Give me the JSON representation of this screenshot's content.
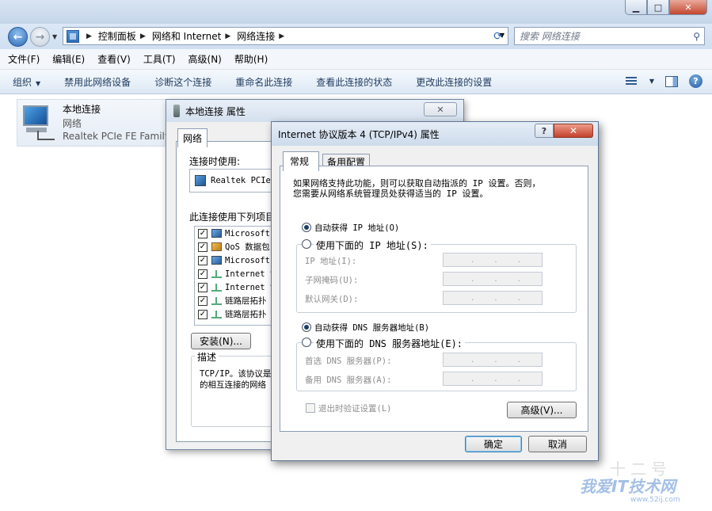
{
  "explorer": {
    "breadcrumb": [
      "控制面板",
      "网络和 Internet",
      "网络连接"
    ],
    "search_placeholder": "搜索 网络连接",
    "menu": [
      "文件(F)",
      "编辑(E)",
      "查看(V)",
      "工具(T)",
      "高级(N)",
      "帮助(H)"
    ],
    "commands": [
      "组织",
      "禁用此网络设备",
      "诊断这个连接",
      "重命名此连接",
      "查看此连接的状态",
      "更改此连接的设置"
    ],
    "connection": {
      "name": "本地连接",
      "type": "网络",
      "device": "Realtek PCIe FE Family"
    }
  },
  "props_dialog": {
    "title": "本地连接 属性",
    "tab": "网络",
    "connect_using_label": "连接时使用:",
    "adapter": "Realtek PCIe",
    "items_label": "此连接使用下列项目",
    "items": [
      "Microsoft",
      "QoS 数据包",
      "Microsoft",
      "Internet 协",
      "Internet 协",
      "链路层拓扑",
      "链路层拓扑"
    ],
    "install_button": "安装(N)...",
    "description_legend": "描述",
    "description_line1": "TCP/IP。该协议是",
    "description_line2": "的相互连接的网络"
  },
  "ipv4_dialog": {
    "title": "Internet 协议版本 4 (TCP/IPv4) 属性",
    "help_glyph": "?",
    "tabs": [
      "常规",
      "备用配置"
    ],
    "intro_line1": "如果网络支持此功能，则可以获取自动指派的 IP 设置。否则，",
    "intro_line2": "您需要从网络系统管理员处获得适当的 IP 设置。",
    "auto_ip": "自动获得 IP 地址(O)",
    "manual_ip": "使用下面的 IP 地址(S):",
    "ip_label": "IP 地址(I):",
    "mask_label": "子网掩码(U):",
    "gateway_label": "默认网关(D):",
    "auto_dns": "自动获得 DNS 服务器地址(B)",
    "manual_dns": "使用下面的 DNS 服务器地址(E):",
    "dns1_label": "首选 DNS 服务器(P):",
    "dns2_label": "备用 DNS 服务器(A):",
    "validate_label": "退出时验证设置(L)",
    "advanced_button": "高级(V)...",
    "ok_button": "确定",
    "cancel_button": "取消",
    "selected_ip_mode": "auto",
    "selected_dns_mode": "auto"
  },
  "watermark": {
    "main": "我爱IT技术网",
    "url": "www.52ij.com",
    "top": "十二号"
  }
}
